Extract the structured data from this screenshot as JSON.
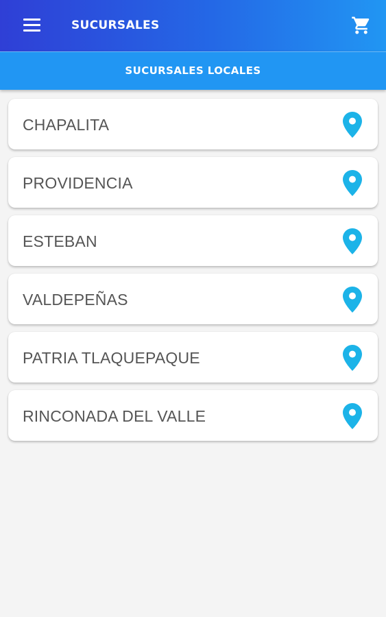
{
  "header": {
    "title": "SUCURSALES",
    "menu_icon": "hamburger-menu-icon",
    "cart_icon": "shopping-cart-icon"
  },
  "tabs": [
    {
      "label": "SUCURSALES LOCALES"
    }
  ],
  "branches": [
    {
      "name": "CHAPALITA"
    },
    {
      "name": "PROVIDENCIA"
    },
    {
      "name": "ESTEBAN"
    },
    {
      "name": "VALDEPEÑAS"
    },
    {
      "name": "PATRIA TLAQUEPAQUE"
    },
    {
      "name": "RINCONADA DEL VALLE"
    }
  ],
  "colors": {
    "header_start": "#2f3fd6",
    "header_end": "#2196f3",
    "tab_bar": "#2196f3",
    "pin": "#1cb3e8",
    "background": "#f4f4f4"
  }
}
